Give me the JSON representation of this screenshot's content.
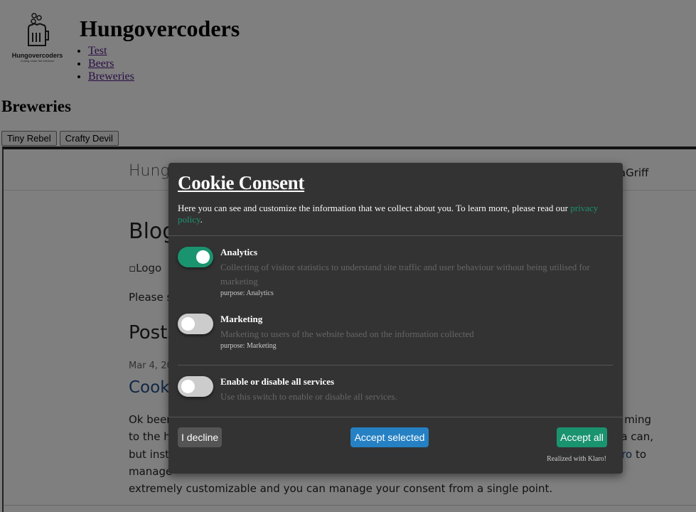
{
  "site": {
    "logo_text": "Hungovercoders",
    "logo_tagline": "Coding under the influence",
    "title": "Hungovercoders",
    "nav": [
      "Test",
      "Beers",
      "Breweries"
    ]
  },
  "section_title": "Breweries",
  "tabs": [
    "Tiny Rebel",
    "Crafty Devil"
  ],
  "frame": {
    "brand": "Hung",
    "user": "taGriff",
    "heading": "Blog",
    "broken_image_alt": "Logo",
    "please": "Please s",
    "posts": "Posts",
    "date": "Mar 4, 20",
    "post_title": "Cook",
    "paragraph": [
      [
        "Ok beer",
        "ming"
      ],
      [
        "to the h",
        "a can,"
      ],
      [
        "but inste",
        "ro",
        "to"
      ],
      [
        "manage",
        ""
      ],
      [
        "extremely customizable and you can manage your consent from a single point."
      ]
    ]
  },
  "modal": {
    "title": "Cookie Consent",
    "description": "Here you can see and customize the information that we collect about you. To learn more, please read our ",
    "privacy_link": "privacy policy",
    "services": [
      {
        "name": "Analytics",
        "description": "Collecting of visitor statistics to understand site traffic and user behaviour without being utilised for marketing",
        "purpose": "purpose: Analytics",
        "enabled": true
      },
      {
        "name": "Marketing",
        "description": "Marketing to users of the website based on the information collected",
        "purpose": "purpose: Marketing",
        "enabled": false
      }
    ],
    "all": {
      "name": "Enable or disable all services",
      "description": "Use this switch to enable or disable all services.",
      "enabled": false
    },
    "decline": "I decline",
    "accept_selected": "Accept selected",
    "accept_all": "Accept all",
    "realized": "Realized with Klaro!",
    "colors": {
      "bg": "#333333",
      "green": "#1a936f",
      "blue": "#2581c4",
      "grey": "#555555"
    }
  }
}
